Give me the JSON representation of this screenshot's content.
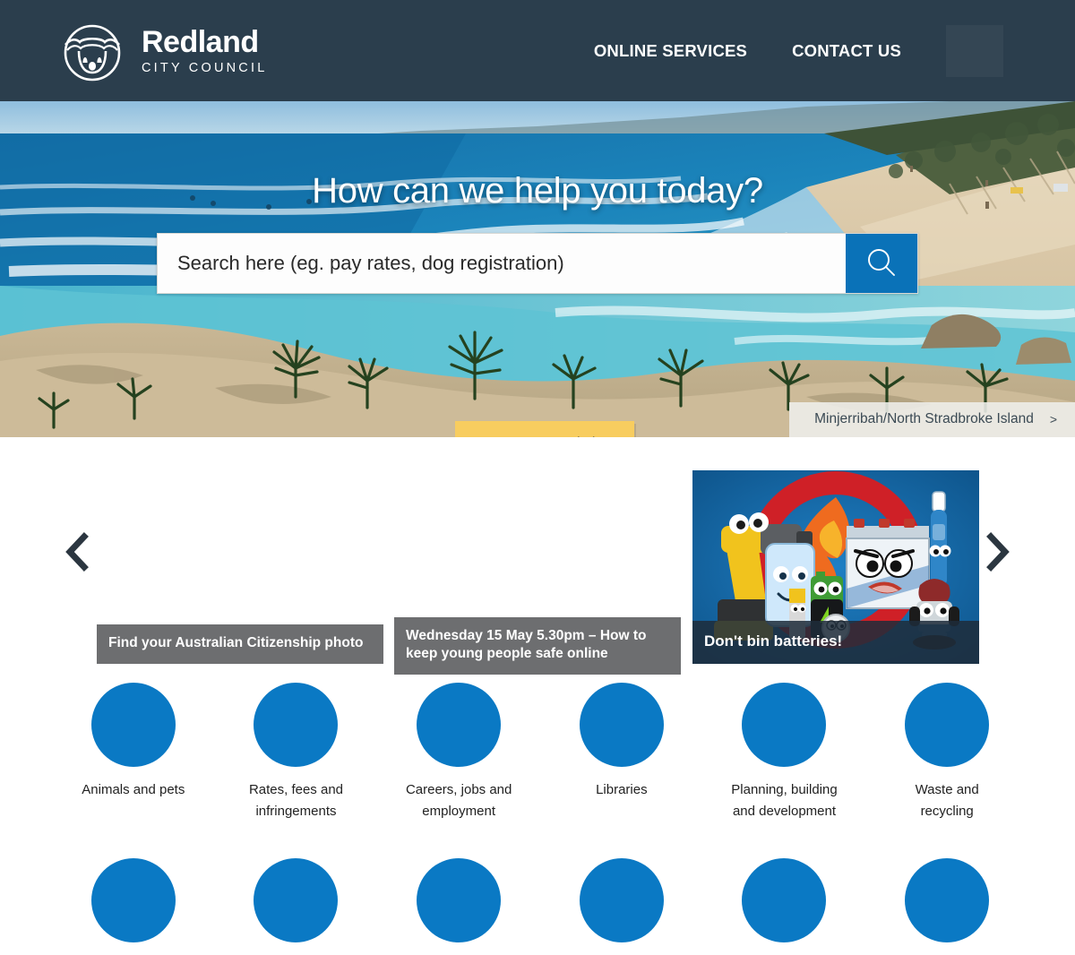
{
  "header": {
    "logo": {
      "icon": "koala-logo-icon",
      "title": "Redland",
      "subtitle": "CITY COUNCIL"
    },
    "nav": [
      {
        "label": "ONLINE SERVICES",
        "name": "nav-online-services"
      },
      {
        "label": "CONTACT US",
        "name": "nav-contact-us"
      }
    ],
    "background_color": "#2b3e4d"
  },
  "hero": {
    "heading": "How can we help you today?",
    "search": {
      "placeholder": "Search here (eg. pay rates, dog registration)",
      "value": "",
      "button_icon": "search-icon",
      "button_color": "#0a72b8"
    },
    "browse_button": {
      "label": "Browse our website",
      "color": "#f8cd5f"
    },
    "image_caption": {
      "label": "Minjerribah/North Stradbroke Island",
      "chevron": ">"
    }
  },
  "carousel": {
    "prev_icon": "chevron-left-icon",
    "next_icon": "chevron-right-icon",
    "cards": [
      {
        "caption": "Find your Australian Citizenship photo",
        "caption_color": "#6d6e70"
      },
      {
        "caption": "Wednesday 15 May 5.30pm – How to keep young people safe online",
        "caption_color": "#6d6e70"
      },
      {
        "caption": "Don't bin batteries!",
        "caption_color": "#1e2c3a"
      }
    ]
  },
  "services": {
    "circle_color": "#0a79c4",
    "row1": [
      {
        "label": "Animals and pets"
      },
      {
        "label": "Rates, fees and infringements"
      },
      {
        "label": "Careers, jobs and employment"
      },
      {
        "label": "Libraries"
      },
      {
        "label": "Planning, building and development"
      },
      {
        "label": "Waste and recycling"
      }
    ],
    "row2": [
      {
        "label": ""
      },
      {
        "label": ""
      },
      {
        "label": ""
      },
      {
        "label": ""
      },
      {
        "label": ""
      },
      {
        "label": ""
      }
    ]
  }
}
